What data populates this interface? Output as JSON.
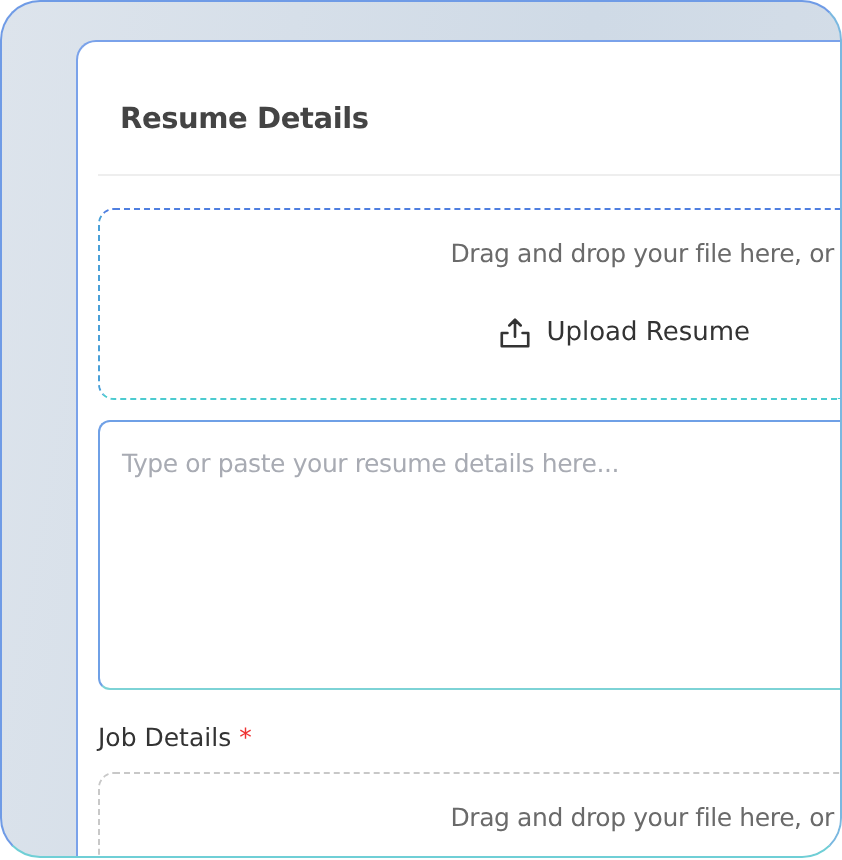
{
  "resume_section": {
    "title": "Resume Details",
    "dropzone": {
      "hint": "Drag and drop your file here, or",
      "button": "Upload Resume"
    },
    "textarea": {
      "placeholder": "Type or paste your resume details here..."
    }
  },
  "job_section": {
    "label": "Job Details",
    "required_mark": "*",
    "dropzone": {
      "hint": "Drag and drop your file here, or"
    }
  }
}
